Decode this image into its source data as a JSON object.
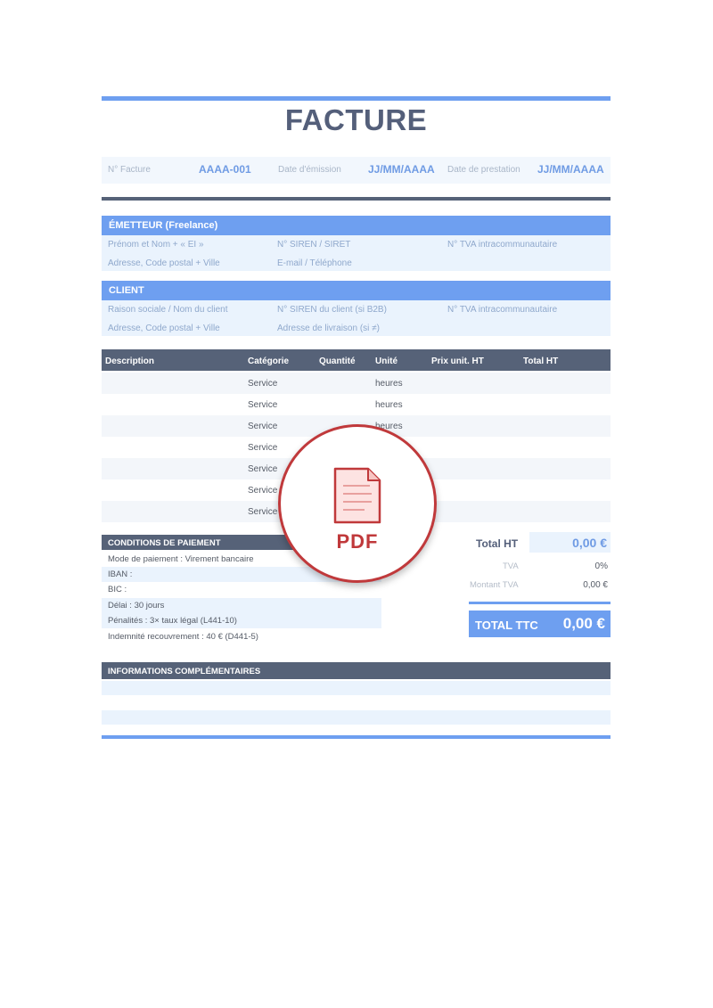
{
  "title": "FACTURE",
  "meta": {
    "invoice_no_label": "N° Facture",
    "invoice_no_value": "AAAA-001",
    "issue_date_label": "Date d'émission",
    "issue_date_value": "JJ/MM/AAAA",
    "service_date_label": "Date de prestation",
    "service_date_value": "JJ/MM/AAAA"
  },
  "emitter": {
    "heading": "ÉMETTEUR (Freelance)",
    "name": "Prénom et Nom + « EI »",
    "siren": "N° SIREN / SIRET",
    "vat": "N° TVA intracommunautaire",
    "address": "Adresse, Code postal + Ville",
    "contact": "E-mail / Téléphone"
  },
  "client": {
    "heading": "CLIENT",
    "name": "Raison sociale / Nom du client",
    "siren": "N° SIREN du client (si B2B)",
    "vat": "N° TVA intracommunautaire",
    "address": "Adresse, Code postal + Ville",
    "delivery": "Adresse de livraison (si ≠)"
  },
  "table": {
    "headers": {
      "description": "Description",
      "category": "Catégorie",
      "quantity": "Quantité",
      "unit": "Unité",
      "unit_price": "Prix unit. HT",
      "total": "Total HT"
    },
    "rows": [
      {
        "category": "Service",
        "unit": "heures"
      },
      {
        "category": "Service",
        "unit": "heures"
      },
      {
        "category": "Service",
        "unit": "heures"
      },
      {
        "category": "Service",
        "unit": ""
      },
      {
        "category": "Service",
        "unit": ""
      },
      {
        "category": "Service",
        "unit": ""
      },
      {
        "category": "Service",
        "unit": ""
      }
    ]
  },
  "payment": {
    "heading": "CONDITIONS DE PAIEMENT",
    "mode": "Mode de paiement : Virement bancaire",
    "iban": "IBAN :",
    "bic": "BIC :",
    "delay": "Délai : 30 jours",
    "penalties": "Pénalités : 3× taux légal (L441-10)",
    "indemnity": "Indemnité recouvrement : 40 € (D441-5)"
  },
  "totals": {
    "ht_label": "Total HT",
    "ht_value": "0,00 €",
    "tva_label": "TVA",
    "tva_value": "0%",
    "tva_amount_label": "Montant TVA",
    "tva_amount_value": "0,00 €",
    "ttc_label": "TOTAL TTC",
    "ttc_value": "0,00 €"
  },
  "info": {
    "heading": "INFORMATIONS COMPLÉMENTAIRES"
  },
  "overlay": {
    "label": "PDF",
    "icon": "pdf-file-icon",
    "accent": "#c0393b"
  },
  "colors": {
    "accent": "#6e9ff0",
    "dark": "#566278",
    "light": "#eaf3fd"
  }
}
